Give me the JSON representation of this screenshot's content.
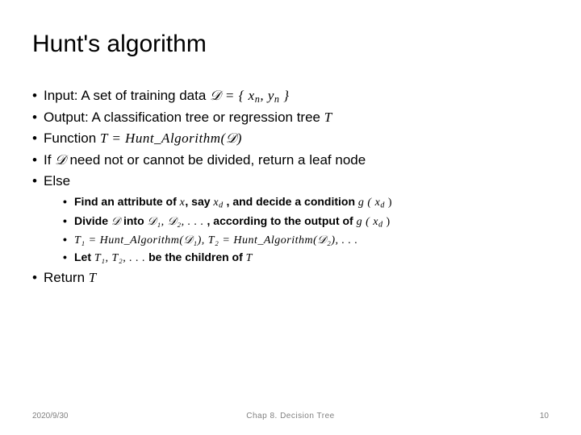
{
  "title": "Hunt's algorithm",
  "bullets": {
    "input_label": "Input: A set of training data ",
    "input_math": "𝒟 = { x",
    "input_math_sub": "n",
    "input_math_mid": ", y",
    "input_math_sub2": "n",
    "input_math_end": " }",
    "output_label": "Output: A classification tree or regression tree ",
    "output_sym": "T",
    "function_label": "Function ",
    "function_math": "T = Hunt_Algorithm(𝒟)",
    "if_prefix": "If ",
    "if_sym": "𝒟",
    "if_suffix": " need not or cannot be divided, return a leaf node",
    "else_label": "Else",
    "return_label": "Return ",
    "return_sym": "T"
  },
  "sub": {
    "find_a": "Find an attribute of ",
    "find_x": "x",
    "find_b": ", say ",
    "find_xd": "x",
    "find_xd_sub": "d",
    "find_c": " , and decide a condition ",
    "find_g": "g ( x",
    "find_g_sub": "d",
    "find_g_end": " )",
    "divide_a": "Divide ",
    "divide_D": "𝒟",
    "divide_b": " into ",
    "divide_list": "𝒟₁, 𝒟₂, . . .",
    "divide_c": " , according to the output of ",
    "divide_g": "g ( x",
    "divide_g_sub": "d",
    "divide_g_end": " )",
    "rec": "T₁ = Hunt_Algorithm(𝒟₁), T₂ = Hunt_Algorithm(𝒟₂), . . .",
    "let_a": "Let ",
    "let_list": "T₁, T₂, . . .",
    "let_b": " be the children of ",
    "let_T": "T"
  },
  "footer": {
    "date": "2020/9/30",
    "chapter": "Chap 8. Decision Tree",
    "page": "10"
  }
}
